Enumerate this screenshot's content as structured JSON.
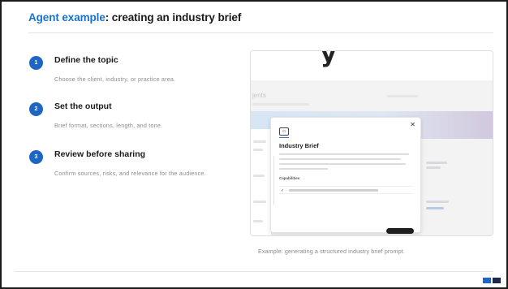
{
  "slide": {
    "title_accent": "Agent example",
    "title_rest": ": creating an industry brief",
    "colors": {
      "accent": "#1a73c9",
      "badge": "#1f66c4",
      "text": "#1a1a1a",
      "muted": "#8c8c8c"
    }
  },
  "steps": [
    {
      "number": "1",
      "title": "Define the topic",
      "description": "Choose the client, industry, or practice area."
    },
    {
      "number": "2",
      "title": "Set the output",
      "description": "Brief format, sections, length, and tone."
    },
    {
      "number": "3",
      "title": "Review before sharing",
      "description": "Confirm sources, risks, and relevance for the audience."
    }
  ],
  "screenshot": {
    "partial_heading": "y",
    "nav_title": "jents",
    "modal": {
      "title": "Industry Brief",
      "capabilities_label": "Capabilities",
      "close_icon": "close-icon",
      "check_icon": "check-icon"
    }
  },
  "caption": "Example: generating a structured industry brief prompt."
}
